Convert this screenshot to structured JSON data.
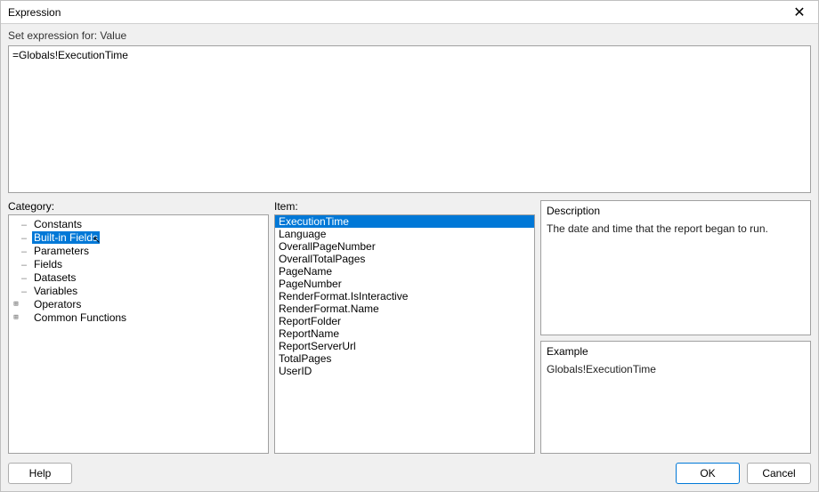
{
  "titlebar": {
    "title": "Expression",
    "close_label": "✕"
  },
  "labels": {
    "set_expression_for": "Set expression for: Value",
    "category": "Category:",
    "item": "Item:",
    "description": "Description",
    "example": "Example"
  },
  "expression": {
    "value": "=Globals!ExecutionTime"
  },
  "category_tree": {
    "items": [
      {
        "label": "Constants",
        "expander": "",
        "connector": "…",
        "selected": false
      },
      {
        "label": "Built-in Fields",
        "expander": "",
        "connector": "…",
        "selected": true,
        "cursor": true
      },
      {
        "label": "Parameters",
        "expander": "",
        "connector": "…",
        "selected": false
      },
      {
        "label": "Fields",
        "expander": "",
        "connector": "…",
        "selected": false
      },
      {
        "label": "Datasets",
        "expander": "",
        "connector": "…",
        "selected": false
      },
      {
        "label": "Variables",
        "expander": "",
        "connector": "…",
        "selected": false
      },
      {
        "label": "Operators",
        "expander": "⊞",
        "connector": "",
        "selected": false
      },
      {
        "label": "Common Functions",
        "expander": "⊞",
        "connector": "",
        "selected": false
      }
    ]
  },
  "item_list": {
    "items": [
      {
        "label": "ExecutionTime",
        "selected": true
      },
      {
        "label": "Language",
        "selected": false
      },
      {
        "label": "OverallPageNumber",
        "selected": false
      },
      {
        "label": "OverallTotalPages",
        "selected": false
      },
      {
        "label": "PageName",
        "selected": false
      },
      {
        "label": "PageNumber",
        "selected": false
      },
      {
        "label": "RenderFormat.IsInteractive",
        "selected": false
      },
      {
        "label": "RenderFormat.Name",
        "selected": false
      },
      {
        "label": "ReportFolder",
        "selected": false
      },
      {
        "label": "ReportName",
        "selected": false
      },
      {
        "label": "ReportServerUrl",
        "selected": false
      },
      {
        "label": "TotalPages",
        "selected": false
      },
      {
        "label": "UserID",
        "selected": false
      }
    ]
  },
  "description_text": "The date and time that the report began to run.",
  "example_text": "Globals!ExecutionTime",
  "buttons": {
    "help": "Help",
    "ok": "OK",
    "cancel": "Cancel"
  }
}
